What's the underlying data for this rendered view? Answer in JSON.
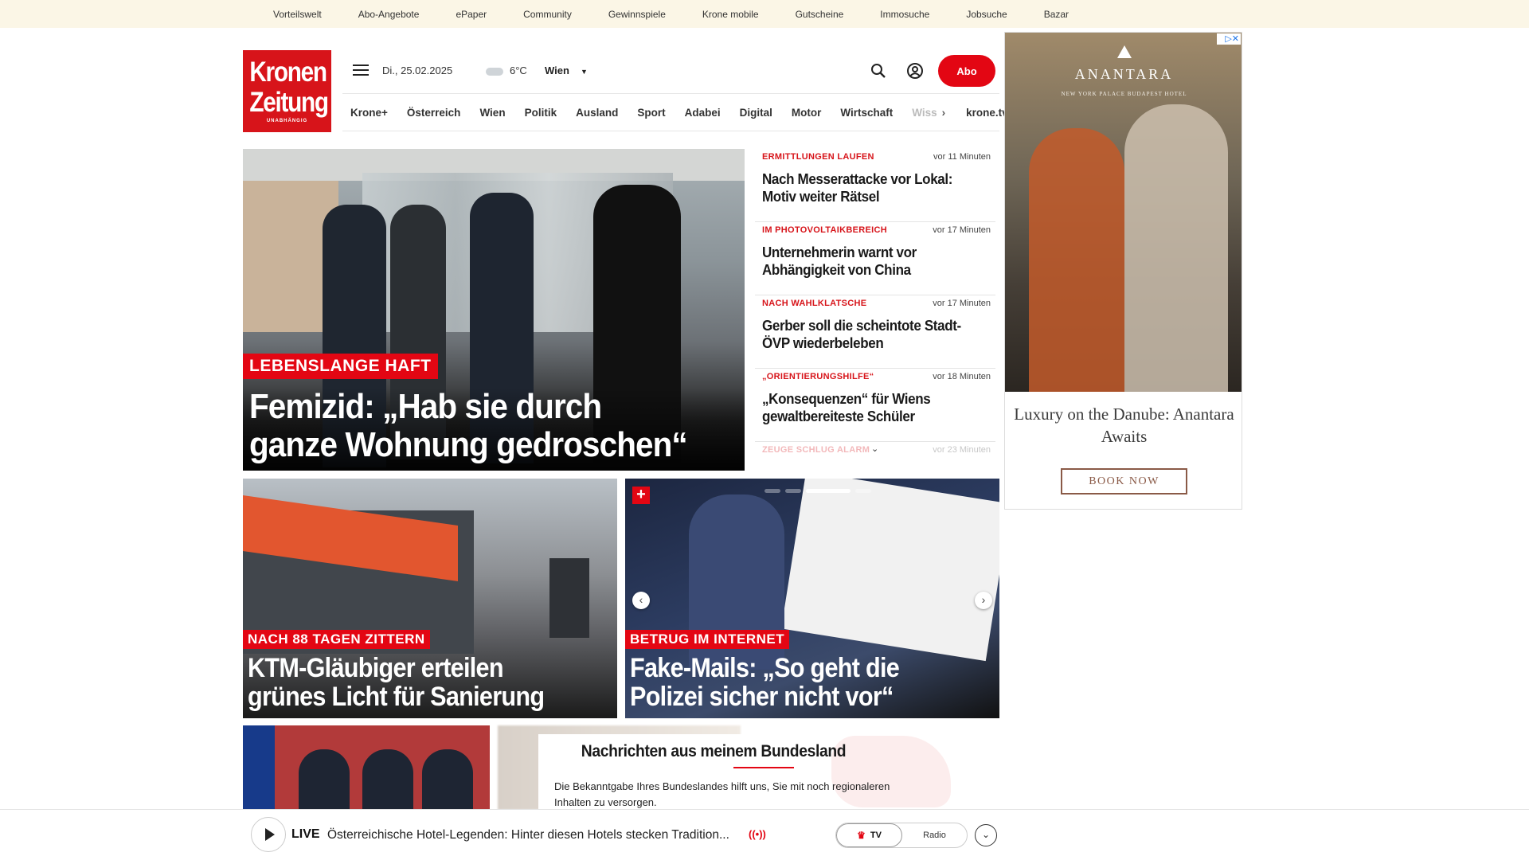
{
  "topbar": {
    "links": [
      "Vorteilswelt",
      "Abo-Angebote",
      "ePaper",
      "Community",
      "Gewinnspiele",
      "Krone mobile",
      "Gutscheine",
      "Immosuche",
      "Jobsuche",
      "Bazar"
    ]
  },
  "logo": {
    "line1": "Kronen",
    "line2": "Zeitung",
    "line3": "UNABHÄNGIG"
  },
  "header": {
    "date": "Di., 25.02.2025",
    "temperature": "6°C",
    "city": "Wien",
    "abo_label": "Abo"
  },
  "nav": {
    "items": [
      "Krone+",
      "Österreich",
      "Wien",
      "Politik",
      "Ausland",
      "Sport",
      "Adabei",
      "Digital",
      "Motor",
      "Wirtschaft"
    ],
    "faded": "Wiss",
    "arrow": "›",
    "krone_tv": "krone.tv"
  },
  "hero": {
    "kicker": "LEBENSLANGE HAFT",
    "title": "Femizid: „Hab sie durch ganze Wohnung gedroschen“"
  },
  "news": [
    {
      "kicker": "ERMITTLUNGEN LAUFEN",
      "time": "vor 11 Minuten",
      "headline": "Nach Messerattacke vor Lokal: Motiv weiter Rätsel"
    },
    {
      "kicker": "IM PHOTOVOLTAIKBEREICH",
      "time": "vor 17 Minuten",
      "headline": "Unternehmerin warnt vor Abhängigkeit von China"
    },
    {
      "kicker": "NACH WAHLKLATSCHE",
      "time": "vor 17 Minuten",
      "headline": "Gerber soll die scheintote Stadt-ÖVP wiederbeleben"
    },
    {
      "kicker": "„ORIENTIERUNGSHILFE“",
      "time": "vor 18 Minuten",
      "headline": "„Konsequenzen“ für Wiens gewaltbereiteste Schüler"
    },
    {
      "kicker": "ZEUGE SCHLUG ALARM",
      "time": "vor 23 Minuten",
      "headline": ""
    }
  ],
  "news_more": "⌄",
  "cards": [
    {
      "kicker": "NACH 88 TAGEN ZITTERN",
      "title": "KTM-Gläubiger erteilen grünes Licht für Sanierung"
    },
    {
      "kicker": "BETRUG IM INTERNET",
      "title": "Fake-Mails: „So geht die Polizei sicher nicht vor“",
      "plus": "+",
      "prev": "‹",
      "next": "›"
    }
  ],
  "bundesland": {
    "title": "Nachrichten aus meinem Bundesland",
    "text": "Die Bekanntgabe Ihres Bundeslandes hilft uns, Sie mit noch regionaleren Inhalten zu versorgen."
  },
  "ad": {
    "brand": "ANANTARA",
    "sub": "NEW YORK PALACE BUDAPEST HOTEL",
    "headline": "Luxury on the Danube: Anantara Awaits",
    "button": "BOOK NOW",
    "close": "▷✕"
  },
  "player": {
    "live": "LIVE",
    "text": "Österreichische Hotel-Legenden: Hinter diesen Hotels stecken Tradition...",
    "radio_icon": "((•))",
    "tv": "TV",
    "tv_icon": "♛",
    "radio": "Radio",
    "expand": "⌄"
  },
  "colors": {
    "brand_red": "#e30613",
    "topbar_bg": "#fbf6e6",
    "ad_button": "#8a5a47"
  }
}
